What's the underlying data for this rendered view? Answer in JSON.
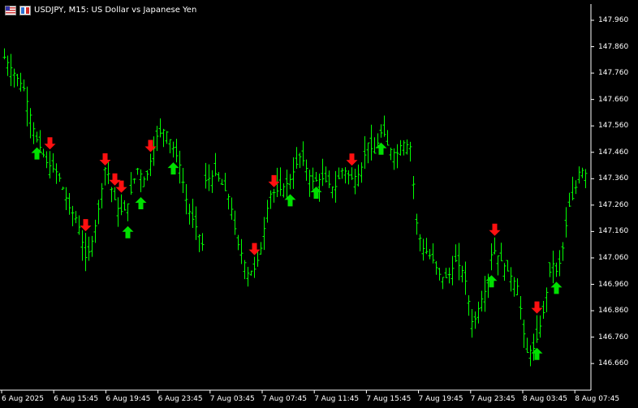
{
  "header": {
    "title": "USDJPY, M15:  US Dollar vs Japanese Yen"
  },
  "colors": {
    "background": "#000000",
    "bars": "#00ff00",
    "buy_arrow": "#00e000",
    "sell_arrow": "#ff1010",
    "axis": "#ffffff"
  },
  "chart_data": {
    "type": "bar",
    "symbol": "USDJPY",
    "timeframe": "M15",
    "y_ticks": [
      "147.960",
      "147.860",
      "147.760",
      "147.660",
      "147.560",
      "147.460",
      "147.360",
      "147.260",
      "147.160",
      "147.060",
      "146.960",
      "146.860",
      "146.760",
      "146.660"
    ],
    "x_ticks": [
      "6 Aug 2025",
      "6 Aug 15:45",
      "6 Aug 19:45",
      "6 Aug 23:45",
      "7 Aug 03:45",
      "7 Aug 07:45",
      "7 Aug 11:45",
      "7 Aug 15:45",
      "7 Aug 19:45",
      "7 Aug 23:45",
      "8 Aug 03:45",
      "8 Aug 07:45"
    ],
    "ylim": [
      146.58,
      148.02
    ],
    "bar_count": 180,
    "close_path": [
      [
        0,
        147.82
      ],
      [
        8,
        147.75
      ],
      [
        14,
        147.7
      ],
      [
        22,
        147.52
      ],
      [
        30,
        147.42
      ],
      [
        38,
        147.38
      ],
      [
        46,
        147.25
      ],
      [
        52,
        147.2
      ],
      [
        58,
        147.05
      ],
      [
        62,
        147.12
      ],
      [
        66,
        147.22
      ],
      [
        72,
        147.42
      ],
      [
        76,
        147.32
      ],
      [
        80,
        147.25
      ],
      [
        84,
        147.23
      ],
      [
        88,
        147.27
      ],
      [
        94,
        147.4
      ],
      [
        100,
        147.35
      ],
      [
        108,
        147.52
      ],
      [
        114,
        147.55
      ],
      [
        118,
        147.5
      ],
      [
        124,
        147.42
      ],
      [
        130,
        147.25
      ],
      [
        134,
        147.2
      ],
      [
        138,
        147.15
      ],
      [
        140,
        147.05
      ],
      [
        142,
        147.35
      ],
      [
        150,
        147.38
      ],
      [
        156,
        147.32
      ],
      [
        160,
        147.28
      ],
      [
        165,
        147.12
      ],
      [
        170,
        147.05
      ],
      [
        172,
        147.0
      ],
      [
        178,
        147.02
      ],
      [
        182,
        147.1
      ],
      [
        188,
        147.3
      ],
      [
        196,
        147.32
      ],
      [
        202,
        147.35
      ],
      [
        206,
        147.4
      ],
      [
        210,
        147.45
      ],
      [
        218,
        147.35
      ],
      [
        226,
        147.36
      ],
      [
        234,
        147.32
      ],
      [
        240,
        147.4
      ],
      [
        246,
        147.36
      ],
      [
        252,
        147.38
      ],
      [
        258,
        147.5
      ],
      [
        262,
        147.45
      ],
      [
        268,
        147.55
      ],
      [
        272,
        147.48
      ],
      [
        278,
        147.45
      ],
      [
        282,
        147.5
      ],
      [
        288,
        147.48
      ],
      [
        292,
        147.2
      ],
      [
        296,
        147.1
      ],
      [
        300,
        147.08
      ],
      [
        304,
        147.05
      ],
      [
        308,
        147.0
      ],
      [
        312,
        146.98
      ],
      [
        316,
        147.0
      ],
      [
        320,
        147.05
      ],
      [
        326,
        147.0
      ],
      [
        332,
        146.8
      ],
      [
        338,
        146.9
      ],
      [
        342,
        146.95
      ],
      [
        346,
        147.1
      ],
      [
        352,
        147.05
      ],
      [
        358,
        147.0
      ],
      [
        364,
        146.95
      ],
      [
        370,
        146.7
      ],
      [
        376,
        146.72
      ],
      [
        382,
        146.85
      ],
      [
        388,
        147.05
      ],
      [
        392,
        147.0
      ],
      [
        396,
        147.1
      ],
      [
        400,
        147.25
      ],
      [
        404,
        147.3
      ],
      [
        408,
        147.4
      ],
      [
        412,
        147.38
      ]
    ],
    "signals": {
      "buy_bar_indices": [
        10,
        38,
        42,
        52,
        88,
        96,
        116,
        150,
        164,
        170
      ],
      "sell_bar_indices": [
        14,
        25,
        31,
        34,
        36,
        45,
        77,
        83,
        107,
        151,
        164
      ]
    }
  }
}
